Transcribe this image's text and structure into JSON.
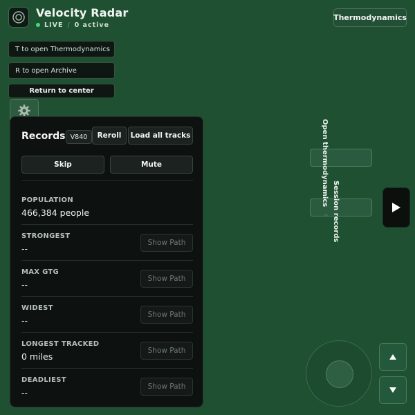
{
  "header": {
    "title": "Velocity Radar",
    "status_live": "LIVE",
    "status_separator": "/",
    "status_active": "0 active",
    "thermodynamics_button": "Thermodynamics"
  },
  "hints": {
    "thermo": "T to open Thermodynamics",
    "archive": "R to open Archive",
    "center": "Return to center"
  },
  "panel": {
    "title": "Records",
    "version": "V840",
    "reroll": "Reroll",
    "load_all": "Load all tracks",
    "skip": "Skip",
    "mute": "Mute",
    "show_path": "Show Path",
    "stats": [
      {
        "label": "POPULATION",
        "value": "466,384 people"
      },
      {
        "label": "STRONGEST",
        "value": "--"
      },
      {
        "label": "MAX GTG",
        "value": "--"
      },
      {
        "label": "WIDEST",
        "value": "--"
      },
      {
        "label": "LONGEST TRACKED",
        "value": "0 miles"
      },
      {
        "label": "DEADLIEST",
        "value": "--"
      }
    ]
  },
  "side": {
    "open_thermo": "Open thermodynamics",
    "session_records": "Session records"
  },
  "icons": {
    "logo": "radar-logo-icon",
    "settings": "gear-icon",
    "play": "play-icon",
    "up": "arrow-up-icon",
    "down": "arrow-down-icon"
  },
  "colors": {
    "map_background": "#1f5032",
    "panel_background": "#0d1110",
    "live_indicator": "#3ddc72"
  }
}
